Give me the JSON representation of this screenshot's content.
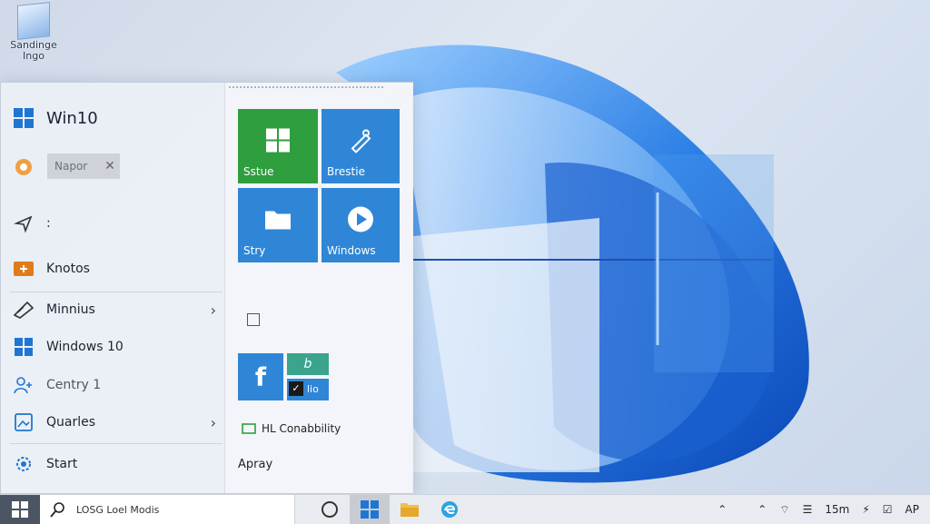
{
  "desktop": {
    "icon_label": "Sandinge Ingo"
  },
  "start_menu": {
    "header_label": "Win10",
    "search_value": "Napor",
    "pinned_label_1": ":",
    "items": [
      {
        "label": "Knotos"
      },
      {
        "label": "Minnius"
      },
      {
        "label": "Windows 10"
      },
      {
        "label": "Centry 1"
      },
      {
        "label": "Quarles"
      },
      {
        "label": "Start"
      }
    ],
    "tiles": [
      {
        "label": "Sstue",
        "color": "#2f9e3f"
      },
      {
        "label": "Brestie",
        "color": "#2f86d6"
      },
      {
        "label": "Stry",
        "color": "#2f86d6"
      },
      {
        "label": "Windows",
        "color": "#2f86d6"
      }
    ],
    "small_tiles": {
      "facebook_glyph": "f",
      "tile_b_glyph": "b",
      "tile_c_text": "lio"
    },
    "compat_label": "HL Conabbility",
    "apply_label": "Apray"
  },
  "taskbar": {
    "search_text": "LOSG Loel Modis",
    "tray": {
      "time": "15m",
      "lang": "AP"
    }
  },
  "colors": {
    "accent": "#1f76d2",
    "tile_green": "#2f9e3f",
    "tile_blue": "#2f86d6"
  }
}
